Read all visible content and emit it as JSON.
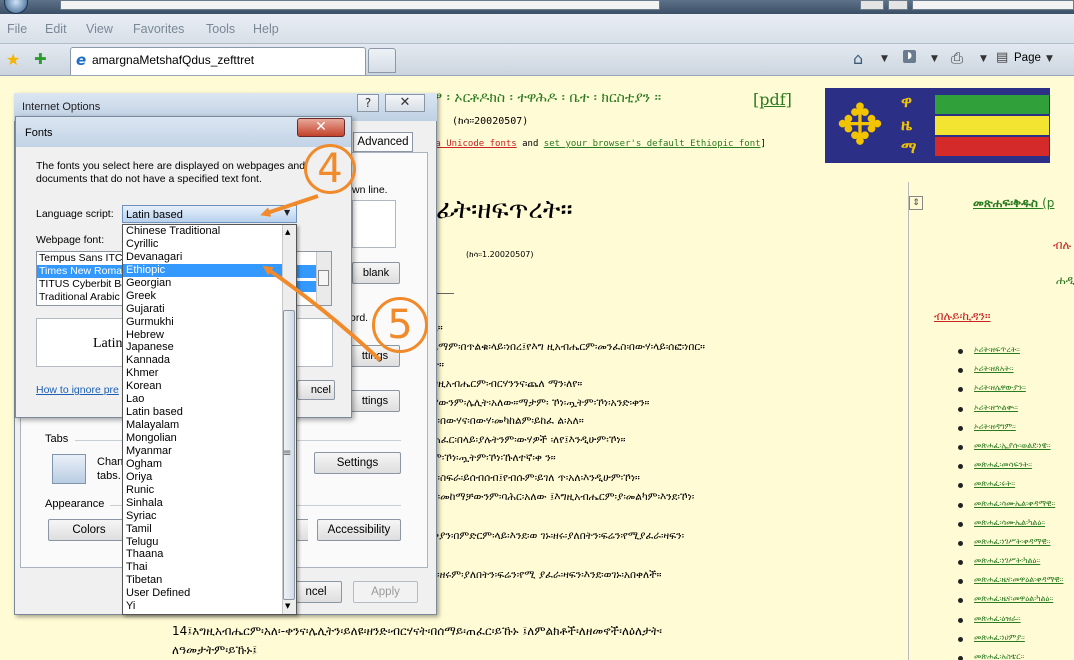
{
  "browser": {
    "menu": [
      "File",
      "Edit",
      "View",
      "Favorites",
      "Tools",
      "Help"
    ],
    "tab_title": "amargnaMetshafQdus_zefttret",
    "toolbar": {
      "page_label": "Page"
    },
    "accent_color": "#1e6ec8"
  },
  "webpage": {
    "heading": "ፆ ፡ ኦርቶዶክስ ፡ ተዋሕዶ ፡ ቤተ ፡ ክርስቲያን ።",
    "pdf_link": "[pdf]",
    "date": "(ከሳ፡፡20020507)",
    "font_line_pre": "ma Unicode fonts",
    "font_line_mid": " and ",
    "font_line_link": "set your browser's default Ethiopic font",
    "font_line_post": "]",
    "logo_letters": [
      "ዋ",
      "ዜ",
      "ማ"
    ],
    "flag_colors": [
      "#2fa03a",
      "#f2e430",
      "#d42a2a"
    ],
    "main_title": "ፊት፡ዘፍጥረት።",
    "date2": "(ከሳ፡፡1.20020507)",
    "body_lines": [
      "ረ።",
      "ለማም፡በጥልቁ፡ላይ፡ነበረ፤የእግ ዚአብሔርም፡መንፈስ፡በውሃ፡ላይ፡ሰፎ፡ነበር።",
      "ት።",
      "ግዚአብሔርም፡ብርሃንንና፡ጨለ ማን፡ለየ።",
      "ያውንም፡ሌሊት፡አለው።ማታም፡ ኾነ፡ጧትም፡ኾነ፡አንድ፡ቀን።",
      "ን፡በውሃና፡በውሃ፡መካከልም፡ይከፈ ል፡አለ።",
      "ጠፈር፡በላይ፡ያሉትንም፡ውሃዎች ፡ለየ፤እንዲሁም፡ኾነ።",
      "ም፡ኾነ፡ጧትም፡ኾነ፡ኹለተኛ፡ቀ ን።",
      "ን፡ስፍራ፡ይሰብሰብ፤የብሱም፡ይገለ ጥ፡አለ፡እንዲሁም፡ኾነ።",
      "ሃ፡መከማቻውንም፡ባሕር፡አለው ፤እግዚአብሔርም፡ያ፡መልካም፡እንደ፡ኾነ፡",
      "ቅያን፡በምድርም፡ላይ፡እንደ፡ወ ገኑ፡ዘሩ፡ያለበትን፡ፍሬን፡የሚያፈራ፡ዛፍን፡",
      "ኑ፡ዘሩም፡ያለበትን፡ፍሬን፡የሚ ያፈራ፡ዛፍን፡እንደ፡ወገኑ፡አበቀለች።"
    ],
    "bottom_lines": [
      "14፤እግዚአብሔርም፡አለ፡-ቀንና፡ሌሊትን፡ይለዩ፡ዘንድ፡ብርሃናት፡በሰማይ፡ጠፈር፡ይኹኑ ፤ለምልክቶች፡ለዘመኖች፡ለዕለታት፡",
      "ለዓመታትም፡ይኹኑ፤"
    ],
    "sidebar": {
      "link1": "መጽሐፍ፡ቅዱስ",
      "link1_paren": "(p",
      "link2": "ብሉ",
      "link3": "ሐዲ",
      "link4": "ብሉይ፡ኪዳን።",
      "items": [
        "ኦሪት፡ዘፍጥረት።",
        "ኦሪት፡ዘጸአት።",
        "ኦሪት፡ዘሌዋውያን።",
        "ኦሪት፡ዘኍልቍ።",
        "ኦሪት፡ዘዳግም።",
        "መጽሐፈ፡ኢያሱ፡ወልደ፡ነዌ።",
        "መጽሐፈ፡መሳፍንት።",
        "መጽሐፈ፡ሩት።",
        "መጽሐፈ፡ሳሙኤል፡ቀዳማዊ።",
        "መጽሐፈ፡ሳሙኤል፡ካልዕ።",
        "መጽሐፈ፡ነገሥት፡ቀዳማዊ።",
        "መጽሐፈ፡ነገሥት፡ካልዕ።",
        "መጽሐፈ፡ዜና፡መዋዕል፡ቀዳማዊ።",
        "መጽሐፈ፡ዜና፡መዋዕል፡ካልዕ።",
        "መጽሐፈ፡ዕዝራ።",
        "መጽሐፈ፡ነሀምያ።",
        "መጽሐፈ፡አስቴር።"
      ]
    }
  },
  "internet_options": {
    "title": "Internet Options",
    "help": "?",
    "close": "✕",
    "tab_advanced": "Advanced",
    "own_line": "wn line.",
    "blank_button": "blank",
    "words": "ord.",
    "settings_partial": "ttings",
    "settings_partial2": "ttings",
    "tabs_legend": "Tabs",
    "tabs_text_1": "Chan",
    "tabs_text_2": "tabs.",
    "tabs_settings": "Settings",
    "appearance_legend": "Appearance",
    "colors": "Colors",
    "accessibility": "Accessibility",
    "cancel": "ncel",
    "apply": "Apply"
  },
  "fonts_dialog": {
    "title": "Fonts",
    "close": "✕",
    "description": "The fonts you select here are displayed on webpages and documents that do not have a specified text font.",
    "language_script_label": "Language script:",
    "language_script_value": "Latin based",
    "webpage_font_label": "Webpage font:",
    "font_list": [
      "Tempus Sans ITC",
      "Times New Roman",
      "TITUS Cyberbit Ba",
      "Traditional Arabic"
    ],
    "selected_font_index": 1,
    "preview": "Latin",
    "ignore_link": "How to ignore pre",
    "cancel": "ncel",
    "scripts": [
      "Chinese Traditional",
      "Cyrillic",
      "Devanagari",
      "Ethiopic",
      "Georgian",
      "Greek",
      "Gujarati",
      "Gurmukhi",
      "Hebrew",
      "Japanese",
      "Kannada",
      "Khmer",
      "Korean",
      "Lao",
      "Latin based",
      "Malayalam",
      "Mongolian",
      "Myanmar",
      "Ogham",
      "Oriya",
      "Runic",
      "Sinhala",
      "Syriac",
      "Tamil",
      "Telugu",
      "Thaana",
      "Thai",
      "Tibetan",
      "User Defined",
      "Yi"
    ],
    "selected_script_index": 3
  },
  "annotations": {
    "step_4": "4",
    "step_5": "5",
    "color": "#f08a2a"
  }
}
